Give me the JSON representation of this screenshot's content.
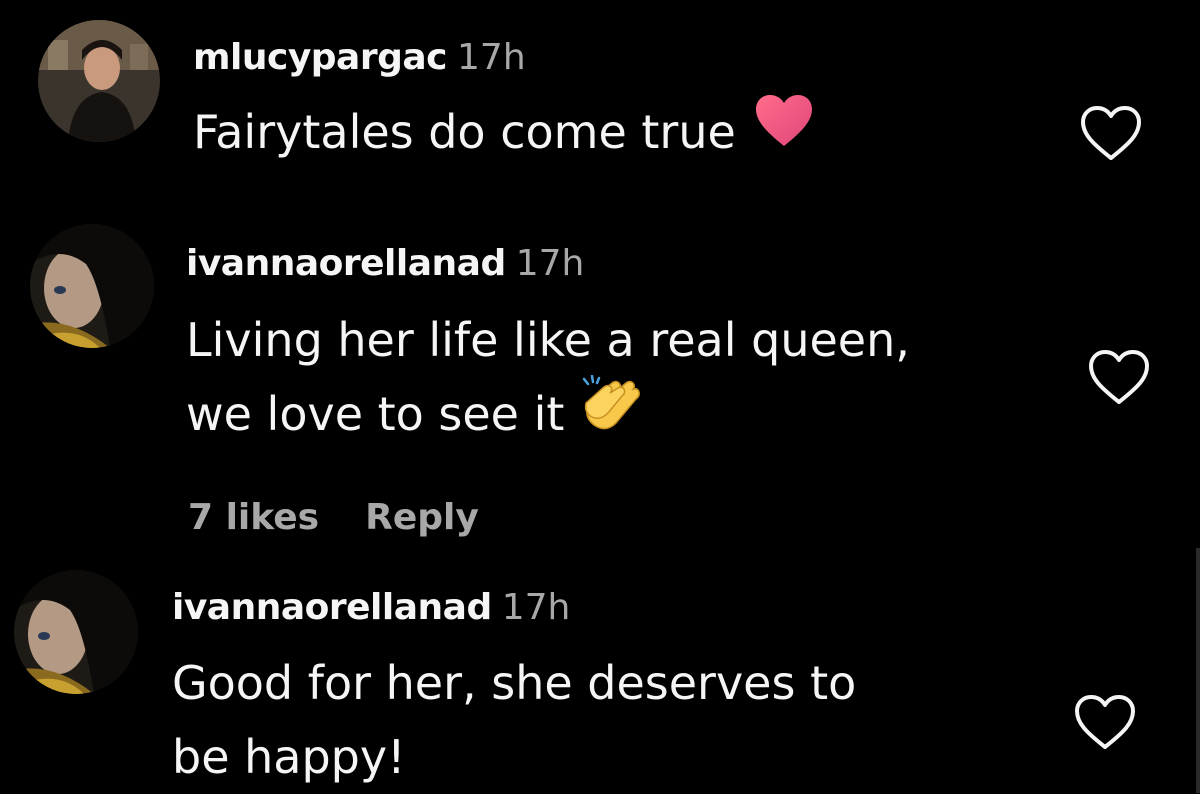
{
  "comments": [
    {
      "username": "mlucypargac",
      "time": "17h",
      "lines": [
        "Fairytales do come true"
      ],
      "emoji_icon": "heart-emoji-icon"
    },
    {
      "username": "ivannaorellanad",
      "time": "17h",
      "lines": [
        "Living her life like a real queen,",
        "we love to see it"
      ],
      "emoji_icon": "clapping-hands-emoji-icon",
      "likes": "7 likes",
      "reply_label": "Reply"
    },
    {
      "username": "ivannaorellanad",
      "time": "17h",
      "lines": [
        "Good for her, she deserves to",
        "be happy!"
      ]
    }
  ],
  "colors": {
    "background": "#000000",
    "primary_text": "#f5f5f5",
    "secondary_text": "#a8a8a8",
    "heart_emoji": "#f0507a"
  }
}
